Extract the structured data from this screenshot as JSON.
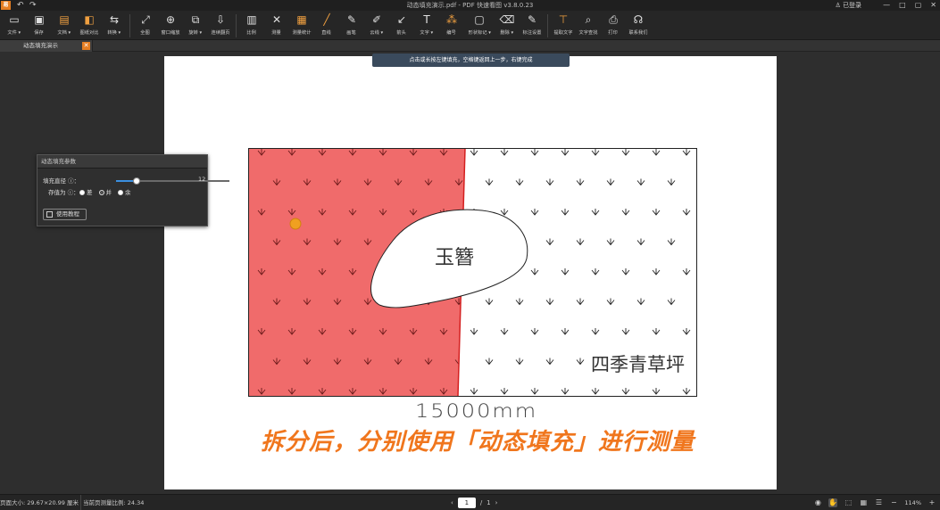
{
  "window": {
    "logo": "易",
    "title": "动态填充演示.pdf - PDF 快速看图 v3.8.0.23",
    "user": "已登录",
    "buttons": [
      "—",
      "□",
      "▢",
      "✕"
    ]
  },
  "toolbar": [
    {
      "id": "file",
      "label": "文件 ▾",
      "icon": "folder-icon",
      "glyph": "▭"
    },
    {
      "id": "save",
      "label": "保存",
      "icon": "save-icon",
      "glyph": "▣"
    },
    {
      "id": "doc",
      "label": "文档 ▾",
      "icon": "document-icon",
      "glyph": "▤",
      "orange": true
    },
    {
      "id": "compare",
      "label": "图纸对比",
      "icon": "compare-icon",
      "glyph": "◧",
      "orange": true
    },
    {
      "id": "convert",
      "label": "转换 ▾",
      "icon": "convert-icon",
      "glyph": "⇆"
    },
    {
      "sep": true
    },
    {
      "id": "fullview",
      "label": "全图",
      "icon": "fullscreen-icon",
      "glyph": "⤢"
    },
    {
      "id": "zoom-window",
      "label": "窗口缩放",
      "icon": "zoom-icon",
      "glyph": "⊕"
    },
    {
      "id": "rotate",
      "label": "旋转 ▾",
      "icon": "rotate-icon",
      "glyph": "⧉"
    },
    {
      "id": "continuous",
      "label": "连续翻页",
      "icon": "page-flip-icon",
      "glyph": "⇩"
    },
    {
      "sep": true
    },
    {
      "id": "scale",
      "label": "比例",
      "icon": "ruler-icon",
      "glyph": "▥"
    },
    {
      "id": "measure",
      "label": "测量",
      "icon": "measure-icon",
      "glyph": "✕"
    },
    {
      "id": "measure-stats",
      "label": "测量统计",
      "icon": "stats-icon",
      "glyph": "▦",
      "orange": true
    },
    {
      "id": "line",
      "label": "直线",
      "icon": "line-icon",
      "glyph": "╱",
      "orange": true
    },
    {
      "id": "pen",
      "label": "画笔",
      "icon": "pen-icon",
      "glyph": "✎"
    },
    {
      "id": "highlight",
      "label": "云线 ▾",
      "icon": "highlighter-icon",
      "glyph": "✐"
    },
    {
      "id": "arrow",
      "label": "箭头",
      "icon": "arrow-icon",
      "glyph": "↙"
    },
    {
      "id": "text",
      "label": "文字 ▾",
      "icon": "text-icon",
      "glyph": "T"
    },
    {
      "id": "number",
      "label": "编号",
      "icon": "numbering-icon",
      "glyph": "⁂",
      "orange": true
    },
    {
      "id": "shape",
      "label": "形状标记 ▾",
      "icon": "shape-icon",
      "glyph": "▢"
    },
    {
      "id": "erase",
      "label": "删除 ▾",
      "icon": "eraser-icon",
      "glyph": "⌫"
    },
    {
      "id": "annot-settings",
      "label": "标注设置",
      "icon": "annotation-settings-icon",
      "glyph": "✎"
    },
    {
      "sep": true
    },
    {
      "id": "extract-text",
      "label": "提取文字",
      "icon": "extract-text-icon",
      "glyph": "⊤",
      "orange": true
    },
    {
      "id": "find-text",
      "label": "文字查找",
      "icon": "search-icon",
      "glyph": "⌕"
    },
    {
      "id": "print",
      "label": "打印",
      "icon": "print-icon",
      "glyph": "⎙"
    },
    {
      "id": "contact",
      "label": "联系我们",
      "icon": "headset-icon",
      "glyph": "☊"
    }
  ],
  "tab": {
    "title": "动态填充演示",
    "close": "✕"
  },
  "hint": "点击或长按左键填充，空格键返回上一步，右键完成",
  "panel": {
    "title": "动态填充参数",
    "radius_label": "填充直径 ⓘ：",
    "radius_value": "12",
    "radius_fraction": 0.18,
    "mode_label": "存值为 ⓘ：",
    "options": [
      "差",
      "并",
      "余"
    ],
    "selected_option": 1,
    "use_button": "使用教程"
  },
  "drawing": {
    "label_stone": "玉簪",
    "label_grass": "四季青草坪",
    "dimension": "15000mm",
    "fill_color": "#f06b6b",
    "annotation": "拆分后，分别使用「动态填充」进行测量",
    "annotation_color": "#f0761d"
  },
  "status": {
    "page_size": "页面大小: 29.67×20.99 厘米",
    "ratio": "当前页测量比例: 24.34",
    "page_current": "1",
    "page_sep": "/",
    "page_total": "1",
    "zoom": "114%"
  }
}
